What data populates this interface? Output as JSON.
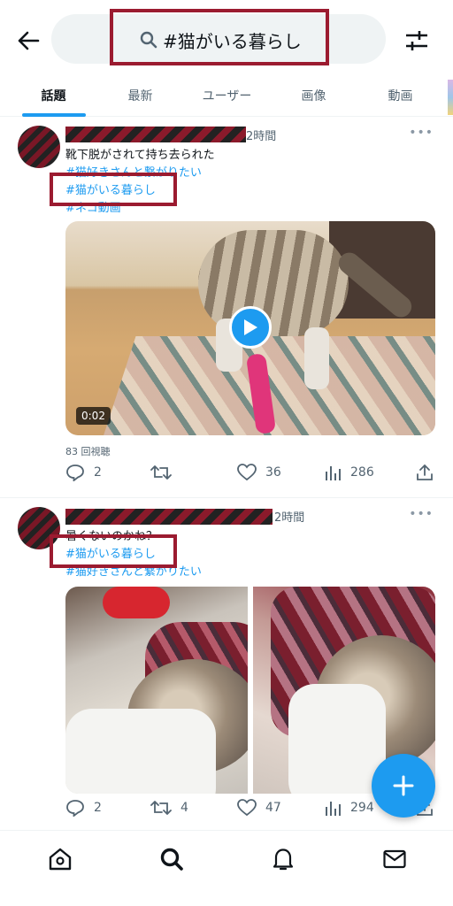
{
  "search": {
    "query": "#猫がいる暮らし"
  },
  "tabs": [
    "話題",
    "最新",
    "ユーザー",
    "画像",
    "動画"
  ],
  "tweets": [
    {
      "time": "2時間",
      "text": "靴下脱がされて持ち去られた",
      "hashtags": [
        "#猫好きさんと繋がりたい",
        "#猫がいる暮らし",
        "#ネコ動画"
      ],
      "duration": "0:02",
      "views": "83 回視聴",
      "replies": "2",
      "retweets": "",
      "likes": "36",
      "impressions": "286"
    },
    {
      "time": "2時間",
      "text": "暑くないのかね？",
      "hashtags": [
        "#猫がいる暮らし",
        "#猫好きさんと繋がりたい"
      ],
      "replies": "2",
      "retweets": "4",
      "likes": "47",
      "impressions": "294"
    }
  ],
  "colors": {
    "accent": "#1d9bf0",
    "highlight": "#9b1b30"
  }
}
